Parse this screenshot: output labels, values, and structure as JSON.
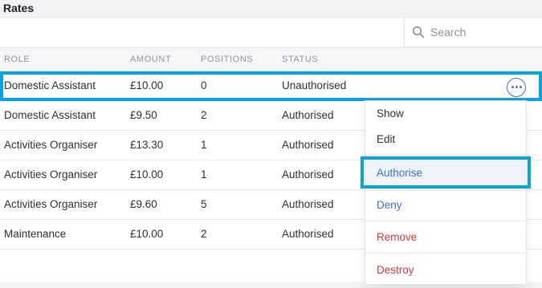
{
  "page": {
    "title": "Rates"
  },
  "search": {
    "placeholder": "Search"
  },
  "columns": [
    "ROLE",
    "AMOUNT",
    "POSITIONS",
    "STATUS"
  ],
  "rows": [
    {
      "role": "Domestic Assistant",
      "amount": "£10.00",
      "positions": "0",
      "status": "Unauthorised"
    },
    {
      "role": "Domestic Assistant",
      "amount": "£9.50",
      "positions": "2",
      "status": "Authorised"
    },
    {
      "role": "Activities Organiser",
      "amount": "£13.30",
      "positions": "1",
      "status": "Authorised"
    },
    {
      "role": "Activities Organiser",
      "amount": "£10.00",
      "positions": "1",
      "status": "Authorised"
    },
    {
      "role": "Activities Organiser",
      "amount": "£9.60",
      "positions": "5",
      "status": "Authorised"
    },
    {
      "role": "Maintenance",
      "amount": "£10.00",
      "positions": "2",
      "status": "Authorised"
    }
  ],
  "menu": {
    "show": "Show",
    "edit": "Edit",
    "authorise": "Authorise",
    "deny": "Deny",
    "remove": "Remove",
    "destroy": "Destroy"
  },
  "icons": {
    "search": "search-icon",
    "more": "more-horizontal-icon"
  },
  "colors": {
    "highlight": "#0aa3e0",
    "accent": "#3b6fd8",
    "danger": "#d33a3a"
  }
}
